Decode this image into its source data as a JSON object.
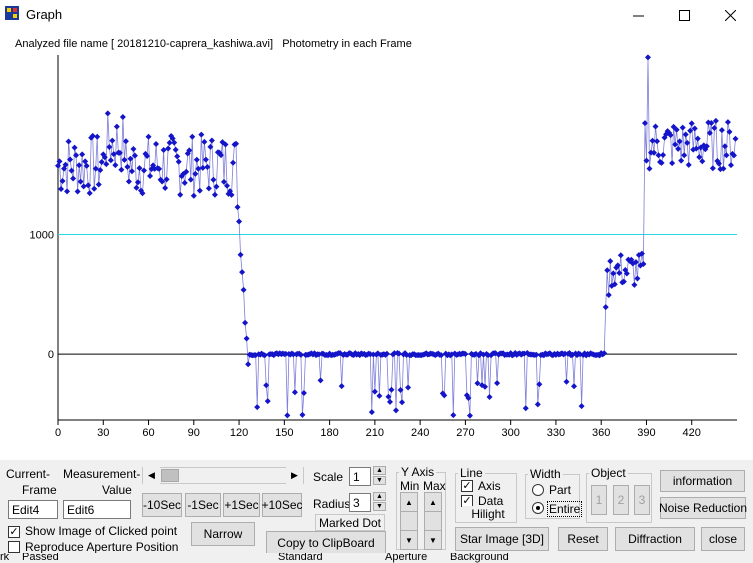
{
  "window": {
    "title": "Graph",
    "minimize_icon": "minimize-icon",
    "maximize_icon": "maximize-icon",
    "close_icon": "close-icon"
  },
  "graph": {
    "header": "Analyzed file name [ 20181210-caprera_kashiwa.avi]   Photometry in each Frame"
  },
  "chart_data": {
    "type": "line",
    "title": "",
    "xlabel": "",
    "ylabel": "",
    "x_ticks": [
      0,
      30,
      60,
      90,
      120,
      150,
      180,
      210,
      240,
      270,
      300,
      330,
      360,
      390,
      420
    ],
    "y_ticks": [
      0,
      1000
    ],
    "reference_line": 1000,
    "reference_color": "#2ad8e4",
    "zero_line_color": "#000000",
    "series_color": "#1414c8",
    "line_color": "#7f7fd9",
    "segments": [
      {
        "from": 0,
        "to": 119,
        "level": 1580,
        "spread": 230
      },
      {
        "from": 119,
        "to": 127,
        "level": "drop",
        "spread": 0
      },
      {
        "from": 127,
        "to": 363,
        "level": 0,
        "spread": 8
      },
      {
        "from": 363,
        "to": 389,
        "level": 750,
        "spread": 120
      },
      {
        "from": 389,
        "to": 450,
        "level": 1700,
        "spread": 200
      }
    ],
    "x_range": [
      0,
      450
    ],
    "y_range": [
      -550,
      2500
    ]
  },
  "controls": {
    "current_frame_label1": "Current-",
    "current_frame_label2": "Frame",
    "measurement_label1": "Measurement-",
    "measurement_label2": "Value",
    "edit4": "Edit4",
    "edit6": "Edit6",
    "btn_m10": "-10Sec",
    "btn_m1": "-1Sec",
    "btn_p1": "+1Sec",
    "btn_p10": "+10Sec",
    "scale_label": "Scale",
    "scale_value": "1",
    "radius_label": "Radius",
    "radius_value": "3",
    "marked_dot": "Marked Dot",
    "yaxis_label": "Y Axis",
    "min_label": "Min",
    "max_label": "Max",
    "line_label": "Line",
    "axis_label": "Axis",
    "data_label": "Data",
    "hilight_label": "Hilight",
    "width_label": "Width",
    "part_label": "Part",
    "entire_label": "Entire",
    "object_label": "Object",
    "obj1": "1",
    "obj2": "2",
    "obj3": "3",
    "information": "information",
    "noise_reduction": "Noise Reduction",
    "narrow": "Narrow",
    "copy": "Copy to ClipBoard",
    "star_image": "Star Image [3D]",
    "reset": "Reset",
    "diffraction": "Diffraction",
    "close": "close",
    "show_image": "Show Image of Clicked point",
    "reproduce": "Reproduce Aperture Position"
  },
  "statusbar": {
    "s1": "rk",
    "s2": "Passed",
    "s3": "Standard",
    "s4": "Aperture",
    "s5": "Background"
  }
}
